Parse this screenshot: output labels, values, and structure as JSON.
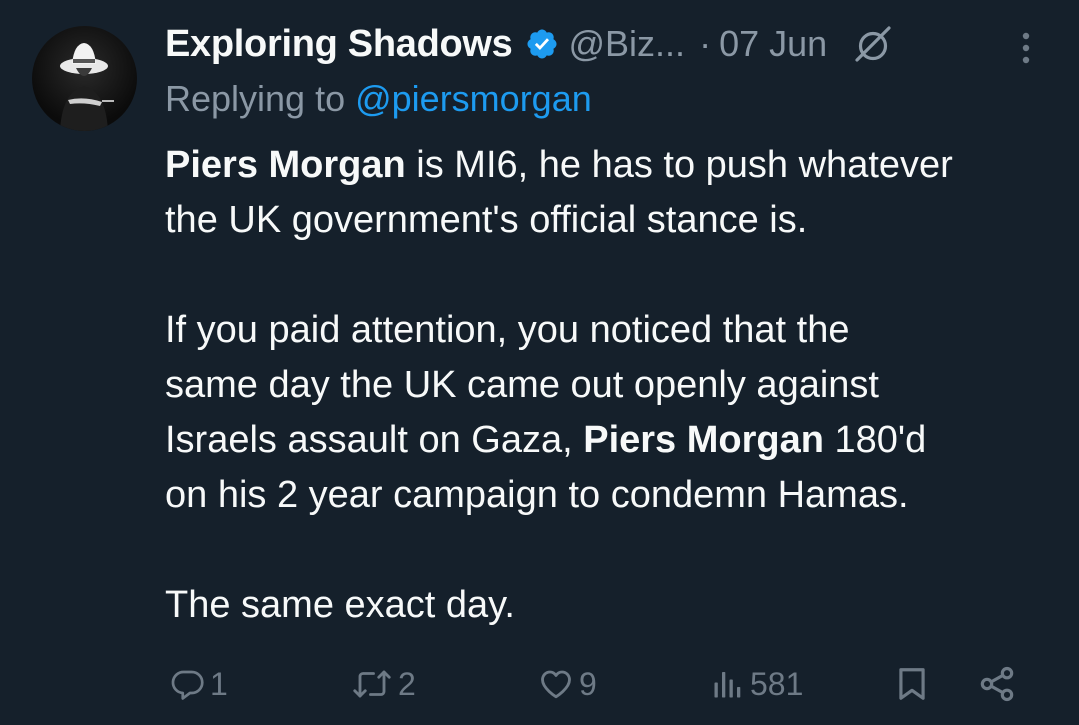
{
  "tweet": {
    "author": {
      "display_name": "Exploring Shadows",
      "handle": "@Biz...",
      "verified_icon": "verified-badge-icon",
      "avatar": "avatar-man-in-white-hat"
    },
    "dot": "·",
    "date": "07 Jun",
    "replying_prefix": "Replying to ",
    "replying_to": "@piersmorgan",
    "body": {
      "p1_bold": "Piers Morgan",
      "p1_rest_line1": " is MI6, he has to push whatever",
      "p1_line2": "the UK government's official stance is.",
      "p2_line1": "If you paid attention, you noticed that the",
      "p2_line2": "same day the UK came out openly against",
      "p2_line3_pre": "Israels assault on Gaza, ",
      "p2_line3_bold": "Piers Morgan",
      "p2_line3_post": " 180'd",
      "p2_line4": "on his 2 year campaign to condemn Hamas.",
      "p3": "The same exact day."
    },
    "actions": {
      "replies": "1",
      "retweets": "2",
      "likes": "9",
      "views": "581"
    },
    "colors": {
      "background": "#15202b",
      "text": "#f7f9f9",
      "muted": "#8b98a5",
      "accent": "#1d9bf0",
      "action": "#6e7a86"
    },
    "icons": [
      "grok-icon",
      "more-icon",
      "reply-icon",
      "retweet-icon",
      "like-icon",
      "views-icon",
      "bookmark-icon",
      "share-icon"
    ]
  }
}
